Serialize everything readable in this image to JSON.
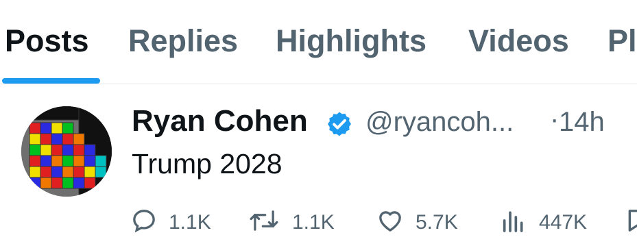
{
  "tabs": [
    {
      "label": "Posts",
      "active": true
    },
    {
      "label": "Replies"
    },
    {
      "label": "Highlights"
    },
    {
      "label": "Videos"
    },
    {
      "label": "Pl"
    }
  ],
  "post": {
    "author_name": "Ryan Cohen",
    "verified": true,
    "handle": "@ryancoh...",
    "separator": "·",
    "time": "14h",
    "text": "Trump 2028",
    "avatar_icon": "tetris-blocks-avatar",
    "actions": [
      {
        "icon": "reply-icon",
        "count": "1.1K"
      },
      {
        "icon": "repost-icon",
        "count": "1.1K"
      },
      {
        "icon": "like-icon",
        "count": "5.7K"
      },
      {
        "icon": "views-icon",
        "count": "447K"
      },
      {
        "icon": "bookmark-icon"
      }
    ]
  },
  "colors": {
    "accent": "#1d9bf0",
    "text_primary": "#0f1419",
    "text_secondary": "#536471"
  }
}
